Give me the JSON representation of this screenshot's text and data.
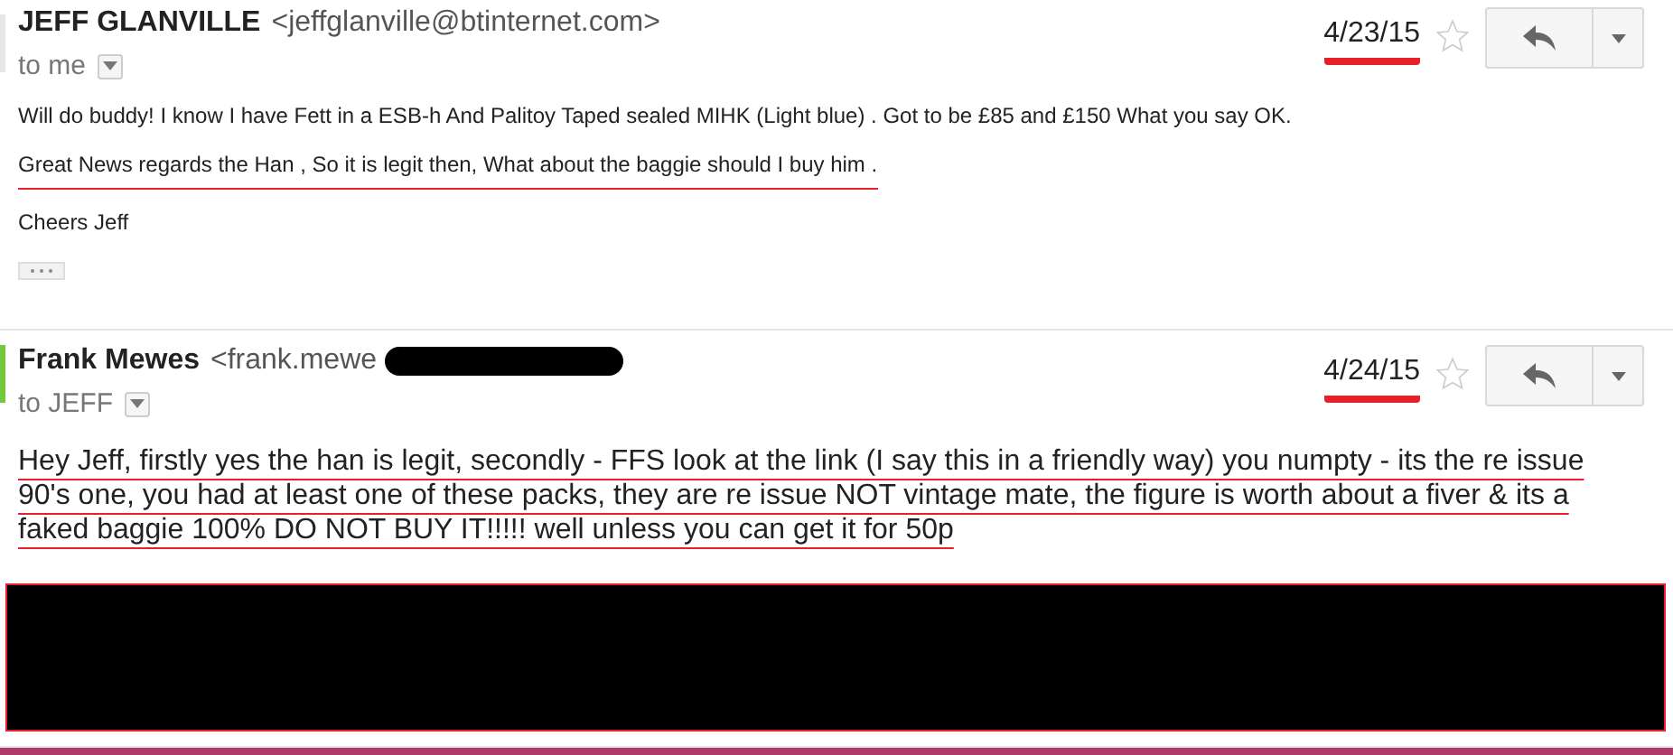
{
  "messages": [
    {
      "kind": "plain",
      "sender": "JEFF GLANVILLE",
      "email": "<jeffglanville@btinternet.com>",
      "email_redacted": false,
      "recipient": "to me",
      "date": "4/23/15",
      "date_marked": true,
      "starred": false,
      "active": false,
      "paragraphs": [
        {
          "text": "Will do buddy! I know I have Fett in a ESB-h And Palitoy Taped sealed MIHK (Light blue) . Got to be £85 and £150 What you say OK.",
          "underlined": false
        },
        {
          "text": "Great News regards the Han , So it is legit then, What about the baggie should I buy him .",
          "underlined": true
        },
        {
          "text": "Cheers Jeff",
          "underlined": false
        }
      ],
      "quote_toggle": true,
      "body_redacted": false
    },
    {
      "kind": "large",
      "sender": "Frank Mewes",
      "email": "<frank.mewe",
      "email_redacted": true,
      "recipient": "to JEFF",
      "date": "4/24/15",
      "date_marked": true,
      "starred": false,
      "active": true,
      "paragraphs": [
        {
          "text": "Hey Jeff, firstly yes the han is legit, secondly - FFS look at the link (I say this in a friendly way) you numpty - its the re issue 90's one, you had at least one of these packs, they are re issue NOT vintage mate, the figure is worth about a fiver & its a faked baggie 100% DO NOT BUY IT!!!!! well unless you can get it for 50p",
          "underlined": true
        }
      ],
      "quote_toggle": false,
      "body_redacted": true
    }
  ]
}
